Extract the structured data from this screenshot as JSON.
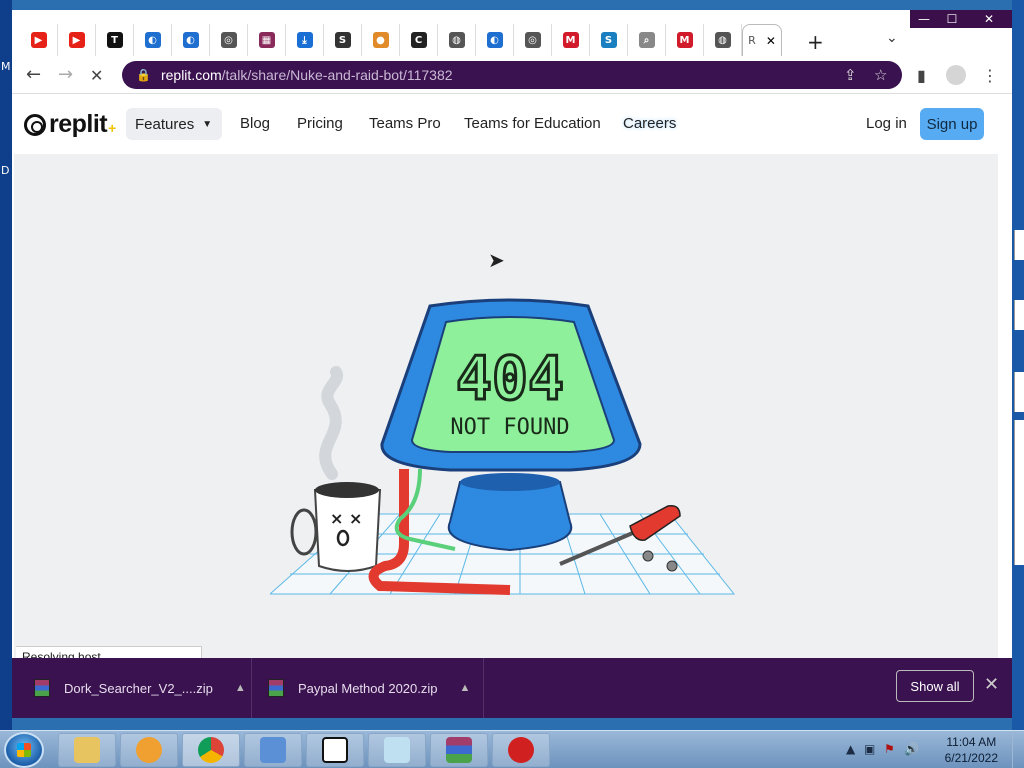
{
  "desktop": {
    "letters": [
      "M",
      "D"
    ]
  },
  "window": {
    "minimize": "—",
    "maximize": "☐",
    "close": "✕"
  },
  "tabs": [
    {
      "icon": "youtube-icon",
      "color": "#e62117",
      "glyph": "▶"
    },
    {
      "icon": "youtube-icon",
      "color": "#e62117",
      "glyph": "▶"
    },
    {
      "icon": "t-icon",
      "color": "#111111",
      "glyph": "T"
    },
    {
      "icon": "swirl-icon",
      "color": "#1f6fd1",
      "glyph": "◐"
    },
    {
      "icon": "swirl-icon",
      "color": "#1f6fd1",
      "glyph": "◐"
    },
    {
      "icon": "chrome-icon",
      "color": "#555555",
      "glyph": "◎"
    },
    {
      "icon": "winrar-icon",
      "color": "#8a2a5a",
      "glyph": "▦"
    },
    {
      "icon": "download-icon",
      "color": "#1a6fd4",
      "glyph": "⤓"
    },
    {
      "icon": "shield-icon",
      "color": "#333333",
      "glyph": "S"
    },
    {
      "icon": "circle-icon",
      "color": "#e08a2a",
      "glyph": "●"
    },
    {
      "icon": "c-icon",
      "color": "#222222",
      "glyph": "C"
    },
    {
      "icon": "globe-icon",
      "color": "#555555",
      "glyph": "◍"
    },
    {
      "icon": "swirl-icon",
      "color": "#1f6fd1",
      "glyph": "◐"
    },
    {
      "icon": "chrome-icon",
      "color": "#555555",
      "glyph": "◎"
    },
    {
      "icon": "m-icon",
      "color": "#d11a2a",
      "glyph": "M"
    },
    {
      "icon": "s-icon",
      "color": "#1a7fc1",
      "glyph": "S"
    },
    {
      "icon": "search-icon",
      "color": "#888888",
      "glyph": "⌕"
    },
    {
      "icon": "m-icon",
      "color": "#d11a2a",
      "glyph": "M"
    },
    {
      "icon": "globe-icon",
      "color": "#555555",
      "glyph": "◍"
    }
  ],
  "active_tab": {
    "label": "R",
    "close": "✕"
  },
  "tabstrip": {
    "new_tab": "+",
    "menu": "⌄"
  },
  "toolbar": {
    "back": "←",
    "forward": "→",
    "reload": "✕",
    "url_host": "replit.com",
    "url_path": "/talk/share/Nuke-and-raid-bot/117382",
    "lock": "🔒",
    "share": "⇪",
    "star": "☆",
    "sidepanel": "▮",
    "menu": "⋮"
  },
  "site": {
    "logo_word": "replit",
    "logo_plus": "+",
    "nav": {
      "features": "Features",
      "blog": "Blog",
      "pricing": "Pricing",
      "teams_pro": "Teams Pro",
      "teams_edu": "Teams for Education",
      "careers": "Careers",
      "login": "Log in",
      "signup": "Sign up"
    },
    "error_code": "404",
    "error_text": "NOT FOUND"
  },
  "status": {
    "text": "Resolving host..."
  },
  "downloads": {
    "items": [
      {
        "name": "Dork_Searcher_V2_....zip"
      },
      {
        "name": "Paypal Method 2020.zip"
      }
    ],
    "show_all": "Show all",
    "close": "✕"
  },
  "taskbar": {
    "time": "11:04 AM",
    "date": "6/21/2022"
  },
  "colors": {
    "accent": "#3b1250",
    "signup": "#57abf2",
    "screen": "#8ef09a",
    "monitor": "#2d8ae0"
  }
}
